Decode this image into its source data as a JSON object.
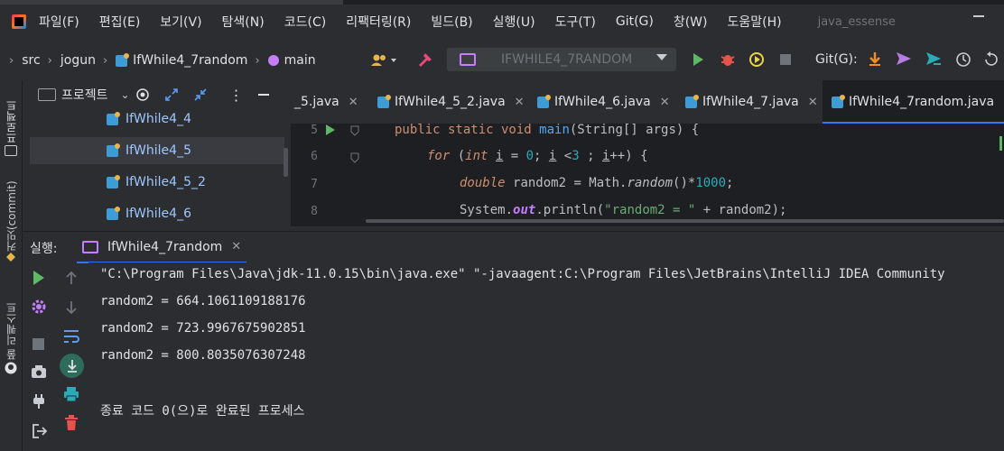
{
  "window": {
    "title": "java_essense"
  },
  "menu": [
    "파일(F)",
    "편집(E)",
    "보기(V)",
    "탐색(N)",
    "코드(C)",
    "리팩터링(R)",
    "빌드(B)",
    "실행(U)",
    "도구(T)",
    "Git(G)",
    "창(W)",
    "도움말(H)"
  ],
  "breadcrumb": {
    "src": "src",
    "pkg": "jogun",
    "file": "IfWhile4_7random",
    "method": "main"
  },
  "run_config": {
    "label": "IFWHILE4_7RANDOM"
  },
  "git": {
    "label": "Git(G):"
  },
  "left_strip": {
    "project": "프로젝트",
    "commit": "커밋(commit)",
    "pull": "풀 리퀘스트"
  },
  "project_panel": {
    "title": "프로젝트",
    "items": [
      "IfWhile4_4",
      "IfWhile4_5",
      "IfWhile4_5_2",
      "IfWhile4_6"
    ]
  },
  "editor_tabs": [
    "_5.java",
    "IfWhile4_5_2.java",
    "IfWhile4_6.java",
    "IfWhile4_7.java",
    "IfWhile4_7random.java"
  ],
  "editor": {
    "line_numbers": [
      "5",
      "6",
      "7",
      "8"
    ],
    "lines": {
      "l5": {
        "kw1": "public static void ",
        "fn": "main",
        "rest": "(String[] args) {"
      },
      "l6": {
        "kw": "for ",
        "p1": "(",
        "kw2": "int ",
        "var1": "i",
        "p2": " = ",
        "n1": "0",
        "p3": "; ",
        "var2": "i",
        "p4": " <",
        "n2": "3",
        "p5": " ; ",
        "var3": "i",
        "p6": "++) {"
      },
      "l7": {
        "kw": "double ",
        "p1": "random2 = Math.",
        "fn": "random",
        "p2": "()*",
        "n": "1000",
        "p3": ";"
      },
      "l8": {
        "p1": "System.",
        "fld": "out",
        "p2": ".println(",
        "str": "\"random2 = \"",
        "p3": " + random2);"
      }
    }
  },
  "run_panel": {
    "label": "실행:",
    "tab": "IfWhile4_7random",
    "console": [
      "\"C:\\Program Files\\Java\\jdk-11.0.15\\bin\\java.exe\" \"-javaagent:C:\\Program Files\\JetBrains\\IntelliJ IDEA Community",
      "random2 = 664.1061109188176",
      "random2 = 723.9967675902851",
      "random2 = 800.8035076307248",
      "",
      "종료 코드 0(으)로 완료된 프로세스"
    ]
  },
  "colors": {
    "accent": "#3574f0",
    "run_green": "#5fb865",
    "debug_red": "#e5534b"
  }
}
